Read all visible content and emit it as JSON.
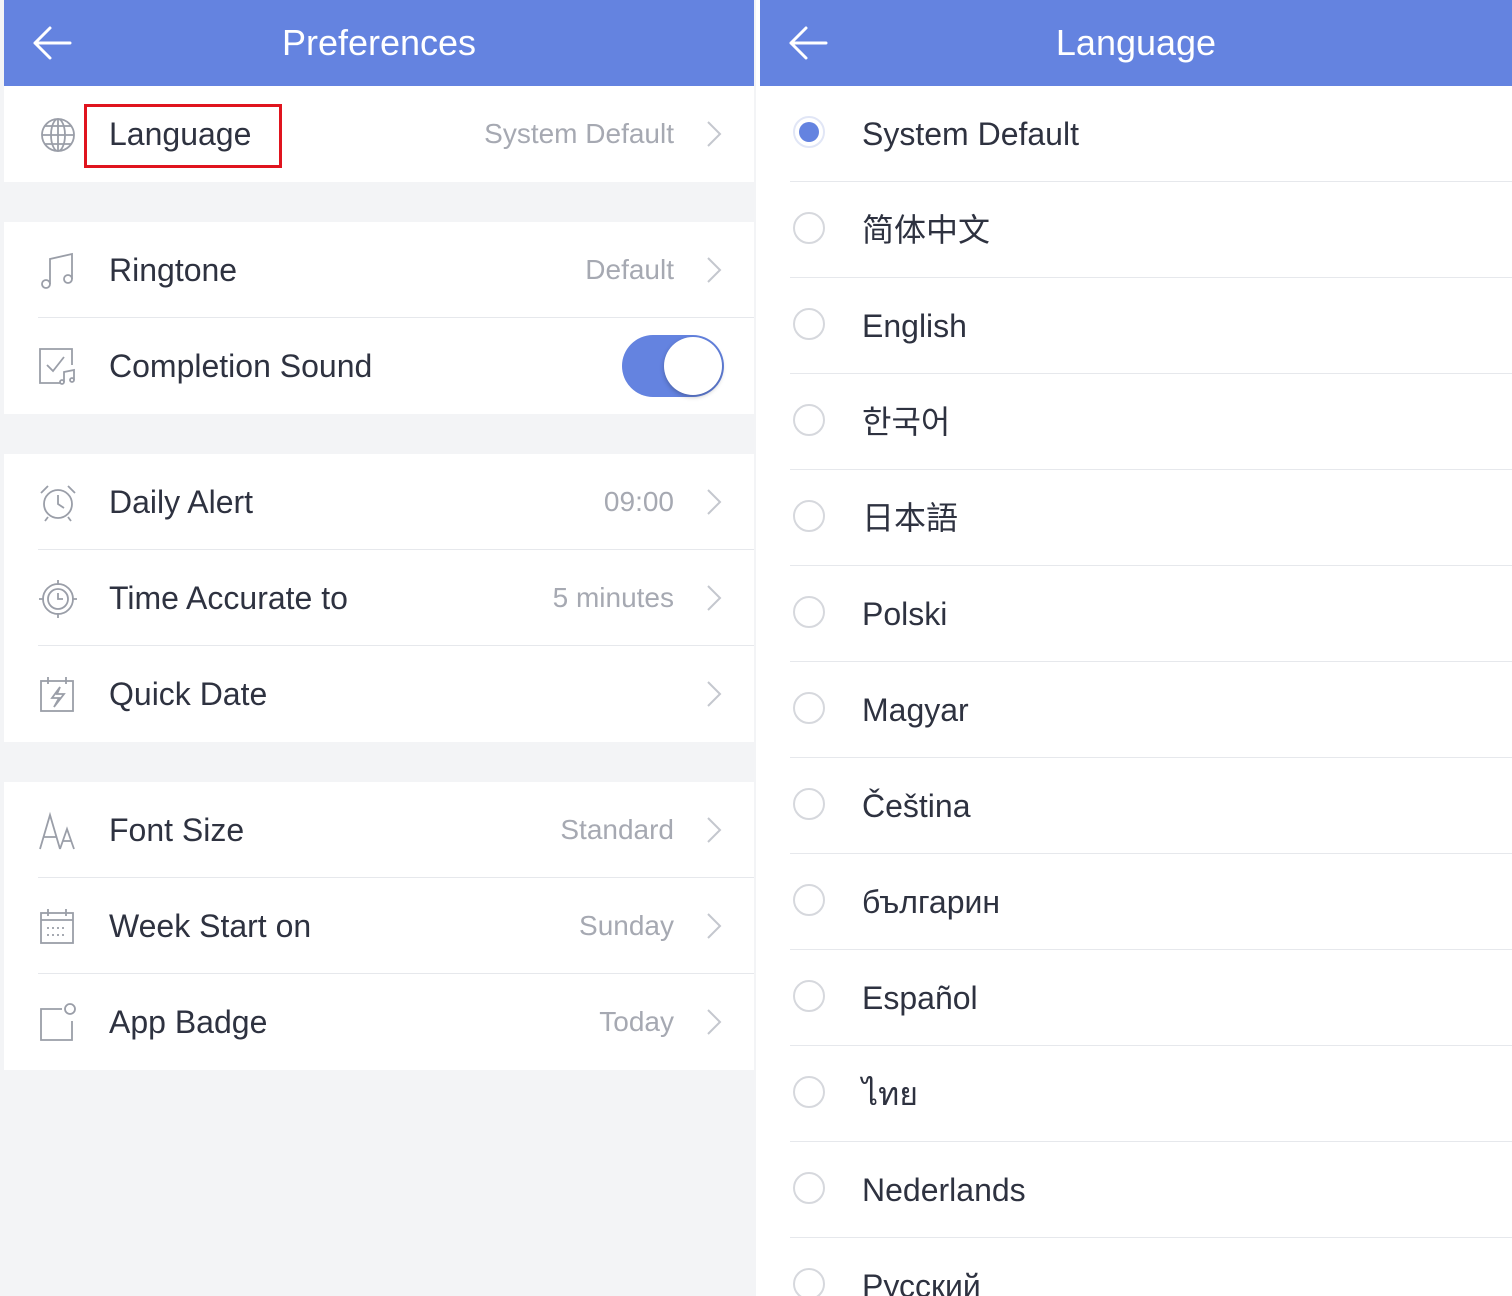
{
  "colors": {
    "accent": "#6483e0",
    "highlight_box": "#e0141e",
    "group_background": "#f3f4f6"
  },
  "preferences": {
    "title": "Preferences",
    "rows": {
      "language": {
        "label": "Language",
        "value": "System Default",
        "icon": "globe-icon"
      },
      "ringtone": {
        "label": "Ringtone",
        "value": "Default",
        "icon": "music-note-icon"
      },
      "completion_sound": {
        "label": "Completion Sound",
        "toggle_on": true,
        "icon": "check-sound-icon"
      },
      "daily_alert": {
        "label": "Daily Alert",
        "value": "09:00",
        "icon": "alarm-clock-icon"
      },
      "time_accurate": {
        "label": "Time Accurate to",
        "value": "5 minutes",
        "icon": "target-clock-icon"
      },
      "quick_date": {
        "label": "Quick Date",
        "value": "",
        "icon": "calendar-bolt-icon"
      },
      "font_size": {
        "label": "Font Size",
        "value": "Standard",
        "icon": "font-size-icon"
      },
      "week_start": {
        "label": "Week Start on",
        "value": "Sunday",
        "icon": "calendar-week-icon"
      },
      "app_badge": {
        "label": "App Badge",
        "value": "Today",
        "icon": "badge-icon"
      }
    }
  },
  "language_screen": {
    "title": "Language",
    "selected": "System Default",
    "options": [
      "System Default",
      "简体中文",
      "English",
      "한국어",
      "日本語",
      "Polski",
      "Magyar",
      "Čeština",
      "българин",
      "Español",
      "ไทย",
      "Nederlands",
      "Русский"
    ]
  }
}
